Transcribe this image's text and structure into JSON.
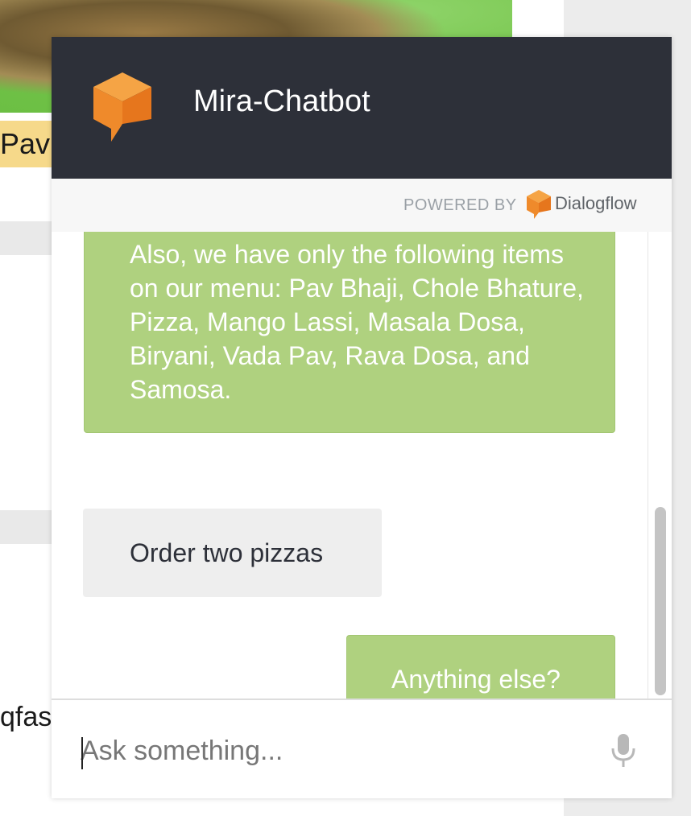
{
  "background_page": {
    "image_label_fragment": "Pav",
    "text_fragment": "qfas"
  },
  "widget": {
    "title": "Mira-Chatbot",
    "powered_by": "POWERED BY",
    "provider": "Dialogflow",
    "input": {
      "placeholder": "Ask something...",
      "value": ""
    },
    "messages": [
      {
        "from": "agent",
        "text": "Also, we have only the following items on our menu: Pav Bhaji, Chole Bhature, Pizza, Mango Lassi, Masala Dosa, Biryani, Vada Pav, Rava Dosa, and Samosa."
      },
      {
        "from": "user",
        "text": "Order two pizzas"
      },
      {
        "from": "agent",
        "text": "Anything else?"
      }
    ]
  },
  "colors": {
    "header_bg": "#2d3039",
    "agent_bubble": "#afd17f",
    "user_bubble": "#eeeeee",
    "dialogflow_orange": "#ef8a2b"
  },
  "icons": {
    "bot_logo": "dialogflow-cube-icon",
    "provider_logo": "dialogflow-logo-icon",
    "mic": "microphone-icon"
  }
}
